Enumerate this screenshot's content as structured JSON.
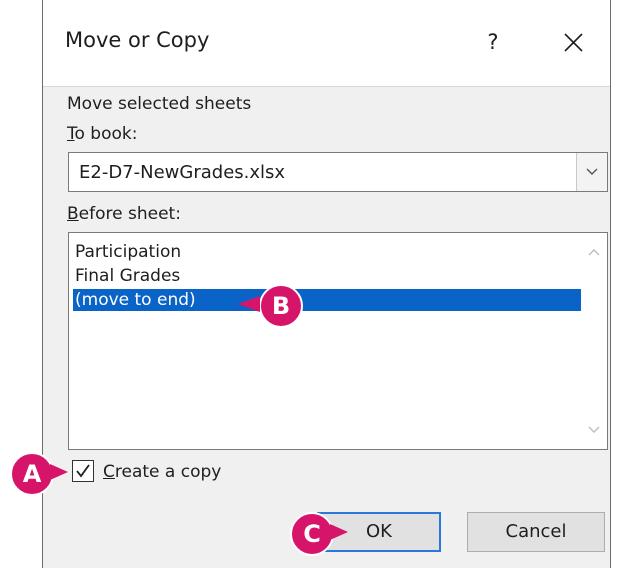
{
  "dialog": {
    "title": "Move or Copy",
    "help_label": "?",
    "move_selected_label": "Move selected sheets",
    "to_book_label_prefix": "T",
    "to_book_label_rest": "o book:",
    "to_book_value": "E2-D7-NewGrades.xlsx",
    "before_sheet_label_prefix": "B",
    "before_sheet_label_rest": "efore sheet:",
    "sheets": [
      "Participation",
      "Final Grades",
      "(move to end)"
    ],
    "selected_sheet_index": 2,
    "create_copy_prefix": "C",
    "create_copy_rest": "reate a copy",
    "create_copy_checked": true,
    "ok_label": "OK",
    "cancel_label": "Cancel"
  },
  "callouts": {
    "a": "A",
    "b": "B",
    "c": "C",
    "color": "#d6146a"
  },
  "colors": {
    "selection": "#0a64c8",
    "default_button_border": "#2b79d6"
  }
}
